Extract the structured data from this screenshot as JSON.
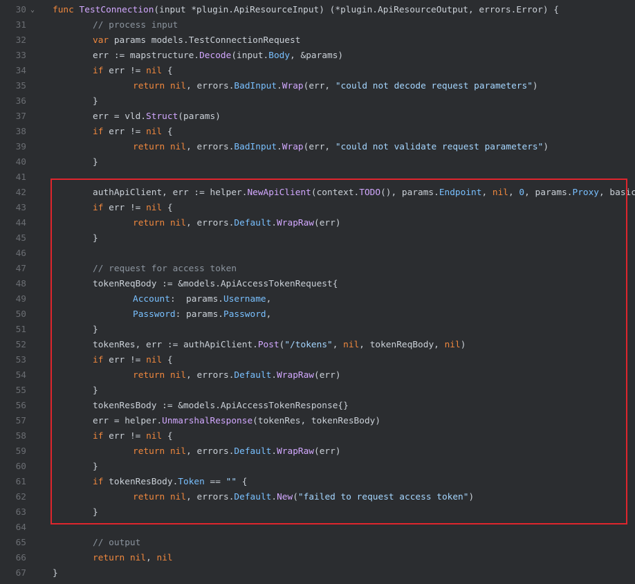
{
  "editor": {
    "lines": [
      {
        "n": "30",
        "fold": "⌄",
        "indent": 0,
        "t": [
          [
            "kw",
            "func"
          ],
          [
            "pl",
            " "
          ],
          [
            "fn",
            "TestConnection"
          ],
          [
            "pl",
            "(input *plugin.ApiResourceInput) (*plugin.ApiResourceOutput, errors.Error) {"
          ]
        ]
      },
      {
        "n": "31",
        "indent": 1,
        "t": [
          [
            "cm",
            "// process input"
          ]
        ]
      },
      {
        "n": "32",
        "indent": 1,
        "t": [
          [
            "kw",
            "var"
          ],
          [
            "pl",
            " params models.TestConnectionRequest"
          ]
        ]
      },
      {
        "n": "33",
        "indent": 1,
        "t": [
          [
            "pl",
            "err := mapstructure."
          ],
          [
            "fn",
            "Decode"
          ],
          [
            "pl",
            "(input."
          ],
          [
            "prop",
            "Body"
          ],
          [
            "pl",
            ", &params)"
          ]
        ]
      },
      {
        "n": "34",
        "indent": 1,
        "t": [
          [
            "kw",
            "if"
          ],
          [
            "pl",
            " err != "
          ],
          [
            "kw",
            "nil"
          ],
          [
            "pl",
            " {"
          ]
        ]
      },
      {
        "n": "35",
        "indent": 2,
        "t": [
          [
            "kw",
            "return"
          ],
          [
            "pl",
            " "
          ],
          [
            "kw",
            "nil"
          ],
          [
            "pl",
            ", errors."
          ],
          [
            "prop",
            "BadInput"
          ],
          [
            "pl",
            "."
          ],
          [
            "fn",
            "Wrap"
          ],
          [
            "pl",
            "(err, "
          ],
          [
            "str",
            "\"could not decode request parameters\""
          ],
          [
            "pl",
            ")"
          ]
        ]
      },
      {
        "n": "36",
        "indent": 1,
        "t": [
          [
            "pl",
            "}"
          ]
        ]
      },
      {
        "n": "37",
        "indent": 1,
        "t": [
          [
            "pl",
            "err = vld."
          ],
          [
            "fn",
            "Struct"
          ],
          [
            "pl",
            "(params)"
          ]
        ]
      },
      {
        "n": "38",
        "indent": 1,
        "t": [
          [
            "kw",
            "if"
          ],
          [
            "pl",
            " err != "
          ],
          [
            "kw",
            "nil"
          ],
          [
            "pl",
            " {"
          ]
        ]
      },
      {
        "n": "39",
        "indent": 2,
        "t": [
          [
            "kw",
            "return"
          ],
          [
            "pl",
            " "
          ],
          [
            "kw",
            "nil"
          ],
          [
            "pl",
            ", errors."
          ],
          [
            "prop",
            "BadInput"
          ],
          [
            "pl",
            "."
          ],
          [
            "fn",
            "Wrap"
          ],
          [
            "pl",
            "(err, "
          ],
          [
            "str",
            "\"could not validate request parameters\""
          ],
          [
            "pl",
            ")"
          ]
        ]
      },
      {
        "n": "40",
        "indent": 1,
        "t": [
          [
            "pl",
            "}"
          ]
        ]
      },
      {
        "n": "41",
        "indent": 0,
        "t": []
      },
      {
        "n": "42",
        "indent": 1,
        "t": [
          [
            "pl",
            "authApiClient, err := helper."
          ],
          [
            "fn",
            "NewApiClient"
          ],
          [
            "pl",
            "(context."
          ],
          [
            "fn",
            "TODO"
          ],
          [
            "pl",
            "(), params."
          ],
          [
            "prop",
            "Endpoint"
          ],
          [
            "pl",
            ", "
          ],
          [
            "kw",
            "nil"
          ],
          [
            "pl",
            ", "
          ],
          [
            "num",
            "0"
          ],
          [
            "pl",
            ", params."
          ],
          [
            "prop",
            "Proxy"
          ],
          [
            "pl",
            ", basicRes)"
          ]
        ]
      },
      {
        "n": "43",
        "indent": 1,
        "t": [
          [
            "kw",
            "if"
          ],
          [
            "pl",
            " err != "
          ],
          [
            "kw",
            "nil"
          ],
          [
            "pl",
            " {"
          ]
        ]
      },
      {
        "n": "44",
        "indent": 2,
        "t": [
          [
            "kw",
            "return"
          ],
          [
            "pl",
            " "
          ],
          [
            "kw",
            "nil"
          ],
          [
            "pl",
            ", errors."
          ],
          [
            "prop",
            "Default"
          ],
          [
            "pl",
            "."
          ],
          [
            "fn",
            "WrapRaw"
          ],
          [
            "pl",
            "(err)"
          ]
        ]
      },
      {
        "n": "45",
        "indent": 1,
        "t": [
          [
            "pl",
            "}"
          ]
        ]
      },
      {
        "n": "46",
        "indent": 0,
        "t": []
      },
      {
        "n": "47",
        "indent": 1,
        "t": [
          [
            "cm",
            "// request for access token"
          ]
        ]
      },
      {
        "n": "48",
        "indent": 1,
        "t": [
          [
            "pl",
            "tokenReqBody := &models.ApiAccessTokenRequest{"
          ]
        ]
      },
      {
        "n": "49",
        "indent": 2,
        "t": [
          [
            "prop",
            "Account"
          ],
          [
            "pl",
            ":  params."
          ],
          [
            "prop",
            "Username"
          ],
          [
            "pl",
            ","
          ]
        ]
      },
      {
        "n": "50",
        "indent": 2,
        "t": [
          [
            "prop",
            "Password"
          ],
          [
            "pl",
            ": params."
          ],
          [
            "prop",
            "Password"
          ],
          [
            "pl",
            ","
          ]
        ]
      },
      {
        "n": "51",
        "indent": 1,
        "t": [
          [
            "pl",
            "}"
          ]
        ]
      },
      {
        "n": "52",
        "indent": 1,
        "t": [
          [
            "pl",
            "tokenRes, err := authApiClient."
          ],
          [
            "fn",
            "Post"
          ],
          [
            "pl",
            "("
          ],
          [
            "str",
            "\"/tokens\""
          ],
          [
            "pl",
            ", "
          ],
          [
            "kw",
            "nil"
          ],
          [
            "pl",
            ", tokenReqBody, "
          ],
          [
            "kw",
            "nil"
          ],
          [
            "pl",
            ")"
          ]
        ]
      },
      {
        "n": "53",
        "indent": 1,
        "t": [
          [
            "kw",
            "if"
          ],
          [
            "pl",
            " err != "
          ],
          [
            "kw",
            "nil"
          ],
          [
            "pl",
            " {"
          ]
        ]
      },
      {
        "n": "54",
        "indent": 2,
        "t": [
          [
            "kw",
            "return"
          ],
          [
            "pl",
            " "
          ],
          [
            "kw",
            "nil"
          ],
          [
            "pl",
            ", errors."
          ],
          [
            "prop",
            "Default"
          ],
          [
            "pl",
            "."
          ],
          [
            "fn",
            "WrapRaw"
          ],
          [
            "pl",
            "(err)"
          ]
        ]
      },
      {
        "n": "55",
        "indent": 1,
        "t": [
          [
            "pl",
            "}"
          ]
        ]
      },
      {
        "n": "56",
        "indent": 1,
        "t": [
          [
            "pl",
            "tokenResBody := &models.ApiAccessTokenResponse{}"
          ]
        ]
      },
      {
        "n": "57",
        "indent": 1,
        "t": [
          [
            "pl",
            "err = helper."
          ],
          [
            "fn",
            "UnmarshalResponse"
          ],
          [
            "pl",
            "(tokenRes, tokenResBody)"
          ]
        ]
      },
      {
        "n": "58",
        "indent": 1,
        "t": [
          [
            "kw",
            "if"
          ],
          [
            "pl",
            " err != "
          ],
          [
            "kw",
            "nil"
          ],
          [
            "pl",
            " {"
          ]
        ]
      },
      {
        "n": "59",
        "indent": 2,
        "t": [
          [
            "kw",
            "return"
          ],
          [
            "pl",
            " "
          ],
          [
            "kw",
            "nil"
          ],
          [
            "pl",
            ", errors."
          ],
          [
            "prop",
            "Default"
          ],
          [
            "pl",
            "."
          ],
          [
            "fn",
            "WrapRaw"
          ],
          [
            "pl",
            "(err)"
          ]
        ]
      },
      {
        "n": "60",
        "indent": 1,
        "t": [
          [
            "pl",
            "}"
          ]
        ]
      },
      {
        "n": "61",
        "indent": 1,
        "t": [
          [
            "kw",
            "if"
          ],
          [
            "pl",
            " tokenResBody."
          ],
          [
            "prop",
            "Token"
          ],
          [
            "pl",
            " == "
          ],
          [
            "str",
            "\"\""
          ],
          [
            "pl",
            " {"
          ]
        ]
      },
      {
        "n": "62",
        "indent": 2,
        "t": [
          [
            "kw",
            "return"
          ],
          [
            "pl",
            " "
          ],
          [
            "kw",
            "nil"
          ],
          [
            "pl",
            ", errors."
          ],
          [
            "prop",
            "Default"
          ],
          [
            "pl",
            "."
          ],
          [
            "fn",
            "New"
          ],
          [
            "pl",
            "("
          ],
          [
            "str",
            "\"failed to request access token\""
          ],
          [
            "pl",
            ")"
          ]
        ]
      },
      {
        "n": "63",
        "indent": 1,
        "t": [
          [
            "pl",
            "}"
          ]
        ]
      },
      {
        "n": "64",
        "indent": 0,
        "t": []
      },
      {
        "n": "65",
        "indent": 1,
        "t": [
          [
            "cm",
            "// output"
          ]
        ]
      },
      {
        "n": "66",
        "indent": 1,
        "t": [
          [
            "kw",
            "return"
          ],
          [
            "pl",
            " "
          ],
          [
            "kw",
            "nil"
          ],
          [
            "pl",
            ", "
          ],
          [
            "kw",
            "nil"
          ]
        ]
      },
      {
        "n": "67",
        "indent": 0,
        "t": [
          [
            "pl",
            "}"
          ]
        ]
      }
    ]
  },
  "colors": {
    "background": "#2b2d30",
    "highlight_border": "#e0252d",
    "keyword": "#f0883e",
    "function": "#d2a8ff",
    "property": "#79c0ff",
    "string": "#a5d6ff",
    "comment": "#8b949e"
  }
}
